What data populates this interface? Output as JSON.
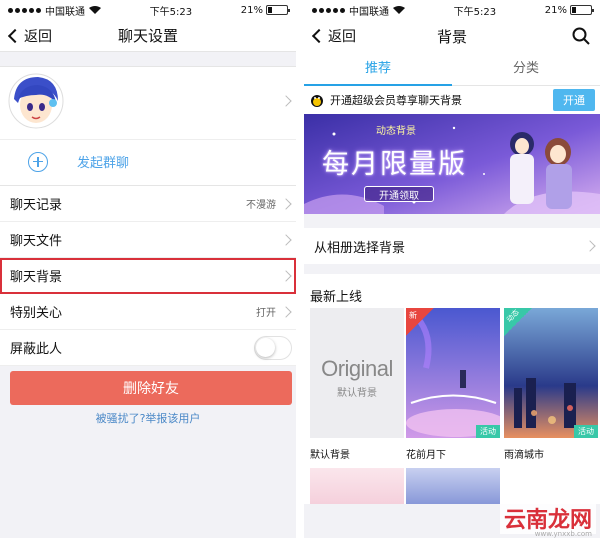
{
  "status": {
    "carrier": "中国联通",
    "time": "下午5:23",
    "battery": "21%"
  },
  "left": {
    "nav": {
      "back": "返回",
      "title": "聊天设置"
    },
    "group_label": "发起群聊",
    "rows": [
      {
        "label": "聊天记录",
        "value": "不漫游"
      },
      {
        "label": "聊天文件",
        "value": ""
      },
      {
        "label": "聊天背景",
        "value": ""
      },
      {
        "label": "特别关心",
        "value": "打开"
      },
      {
        "label": "屏蔽此人",
        "value": ""
      }
    ],
    "delete_label": "删除好友",
    "report_label": "被骚扰了?举报该用户"
  },
  "right": {
    "nav": {
      "back": "返回",
      "title": "背景"
    },
    "tabs": [
      "推荐",
      "分类"
    ],
    "vip_text": "开通超级会员尊享聊天背景",
    "vip_button": "开通",
    "banner": {
      "tag": "动态背景",
      "title": "每月限量版",
      "button": "开通领取"
    },
    "album_label": "从相册选择背景",
    "newest_title": "最新上线",
    "thumbs": [
      {
        "label": "默认背景",
        "orig_text": "Original",
        "orig_sub": "默认背景"
      },
      {
        "label": "花前月下",
        "badge": "新",
        "tag": "活动"
      },
      {
        "label": "雨滴城市",
        "badge": "动态",
        "tag": "活动"
      }
    ],
    "watermark": "云南龙网",
    "watermark_sub": "www.ynxxb.com"
  }
}
